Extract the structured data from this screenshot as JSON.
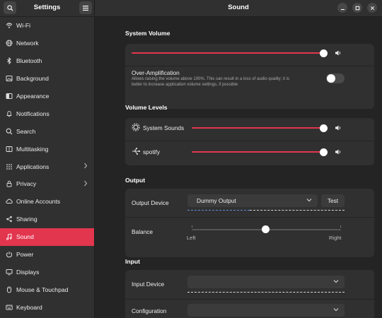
{
  "sidebar": {
    "title": "Settings",
    "items": [
      {
        "label": "Wi-Fi",
        "icon": "wifi-icon"
      },
      {
        "label": "Network",
        "icon": "network-icon"
      },
      {
        "label": "Bluetooth",
        "icon": "bluetooth-icon"
      },
      {
        "label": "Background",
        "icon": "background-icon"
      },
      {
        "label": "Appearance",
        "icon": "appearance-icon"
      },
      {
        "label": "Notifications",
        "icon": "bell-icon"
      },
      {
        "label": "Search",
        "icon": "search-icon"
      },
      {
        "label": "Multitasking",
        "icon": "multitasking-icon"
      },
      {
        "label": "Applications",
        "icon": "applications-icon",
        "chevron": true
      },
      {
        "label": "Privacy",
        "icon": "privacy-icon",
        "chevron": true
      },
      {
        "label": "Online Accounts",
        "icon": "online-accounts-icon"
      },
      {
        "label": "Sharing",
        "icon": "sharing-icon"
      },
      {
        "label": "Sound",
        "icon": "music-note-icon",
        "active": true
      },
      {
        "label": "Power",
        "icon": "power-icon"
      },
      {
        "label": "Displays",
        "icon": "display-icon"
      },
      {
        "label": "Mouse & Touchpad",
        "icon": "mouse-icon"
      },
      {
        "label": "Keyboard",
        "icon": "keyboard-icon"
      }
    ]
  },
  "header": {
    "title": "Sound"
  },
  "system_volume": {
    "title": "System Volume",
    "level": 0.98,
    "over_amplification": {
      "label": "Over-Amplification",
      "note_line1": "Allows raising the volume above 100%. This can result in a loss of audio quality; it is",
      "note_line2": "better to increase application volume settings, if possible",
      "enabled": false
    }
  },
  "volume_levels": {
    "title": "Volume Levels",
    "apps": [
      {
        "label": "System Sounds",
        "icon": "gear-sound-icon",
        "level": 0.98
      },
      {
        "label": "spotify",
        "icon": "spotify-icon",
        "level": 0.98
      }
    ]
  },
  "output": {
    "title": "Output",
    "device_label": "Output Device",
    "device_value": "Dummy Output",
    "test_label": "Test",
    "balance_label": "Balance",
    "balance_left": "Left",
    "balance_right": "Right",
    "balance_value": 0.5
  },
  "input": {
    "title": "Input",
    "device_label": "Input Device",
    "config_label": "Configuration"
  },
  "colors": {
    "accent": "#e2364f",
    "sidebar_bg": "#303030",
    "content_bg": "#242424"
  }
}
